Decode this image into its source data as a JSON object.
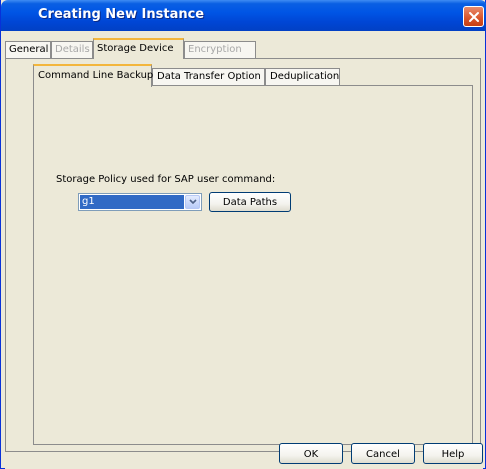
{
  "window": {
    "title": "Creating New Instance"
  },
  "icons": {
    "close": "close-icon",
    "dropdown": "chevron-down-icon"
  },
  "outer_tabs": [
    {
      "label": "General",
      "state": "enabled"
    },
    {
      "label": "Details",
      "state": "disabled"
    },
    {
      "label": "Storage Device",
      "state": "selected"
    },
    {
      "label": "Encryption",
      "state": "disabled"
    }
  ],
  "inner_tabs": [
    {
      "label": "Command Line Backup",
      "state": "selected"
    },
    {
      "label": "Data Transfer Option",
      "state": "enabled"
    },
    {
      "label": "Deduplication",
      "state": "enabled"
    }
  ],
  "command_line_backup": {
    "policy_label": "Storage Policy used for SAP user command:",
    "policy_value": "g1",
    "data_paths_label": "Data Paths"
  },
  "footer": {
    "ok_label": "OK",
    "cancel_label": "Cancel",
    "help_label": "Help"
  },
  "colors": {
    "titlebar": "#0055e5",
    "selected_tab_accent": "#f3b63c",
    "close_button": "#d9542a",
    "selection": "#316ac5"
  }
}
